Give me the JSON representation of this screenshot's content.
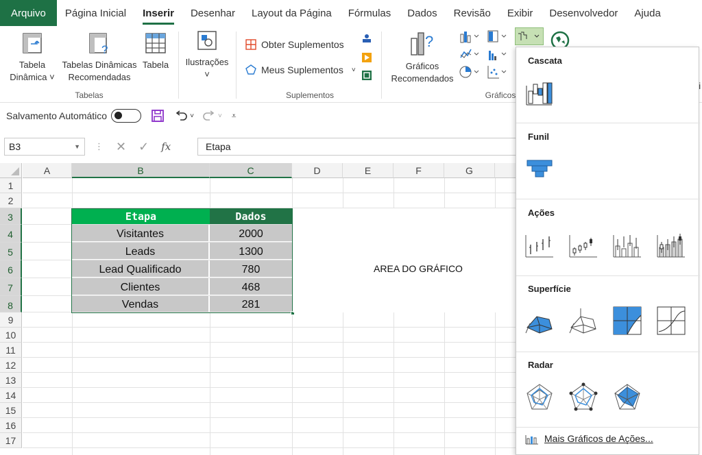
{
  "menu": {
    "tabs": [
      "Arquivo",
      "Página Inicial",
      "Inserir",
      "Desenhar",
      "Layout da Página",
      "Fórmulas",
      "Dados",
      "Revisão",
      "Exibir",
      "Desenvolvedor",
      "Ajuda"
    ],
    "active": "Inserir"
  },
  "ribbon": {
    "tabelas": {
      "pivot_line1": "Tabela",
      "pivot_line2": "Dinâmica",
      "recommended_line1": "Tabelas Dinâmicas",
      "recommended_line2": "Recomendadas",
      "table": "Tabela",
      "group": "Tabelas"
    },
    "illustrations": {
      "label": "Ilustrações"
    },
    "suplementos": {
      "get": "Obter Suplementos",
      "mine": "Meus Suplementos",
      "group": "Suplementos"
    },
    "graficos": {
      "recommended_line1": "Gráficos",
      "recommended_line2": "Recomendados",
      "group": "Gráficos",
      "partial": "Li"
    }
  },
  "qat": {
    "autosave": "Salvamento Automático"
  },
  "formula_bar": {
    "name_box": "B3",
    "fx": "fx",
    "content": "Etapa"
  },
  "sheet": {
    "columns": [
      "A",
      "B",
      "C",
      "D",
      "E",
      "F",
      "G"
    ],
    "rows": [
      "1",
      "2",
      "3",
      "4",
      "5",
      "6",
      "7",
      "8",
      "9",
      "10",
      "11",
      "12",
      "13",
      "14",
      "15",
      "16",
      "17"
    ],
    "table": {
      "headers": [
        "Etapa",
        "Dados"
      ],
      "rows": [
        [
          "Visitantes",
          "2000"
        ],
        [
          "Leads",
          "1300"
        ],
        [
          "Lead Qualificado",
          "780"
        ],
        [
          "Clientes",
          "468"
        ],
        [
          "Vendas",
          "281"
        ]
      ]
    },
    "chart_area_label": "AREA DO GRÁFICO"
  },
  "chart_menu": {
    "sections": [
      "Cascata",
      "Funil",
      "Ações",
      "Superfície",
      "Radar"
    ],
    "more": "Mais Gráficos de Ações..."
  },
  "colors": {
    "accent": "#1e7145",
    "header_green": "#00b050",
    "header_dark": "#217346",
    "table_fill": "#c8c8c8",
    "icon_blue": "#3c8fdc"
  }
}
